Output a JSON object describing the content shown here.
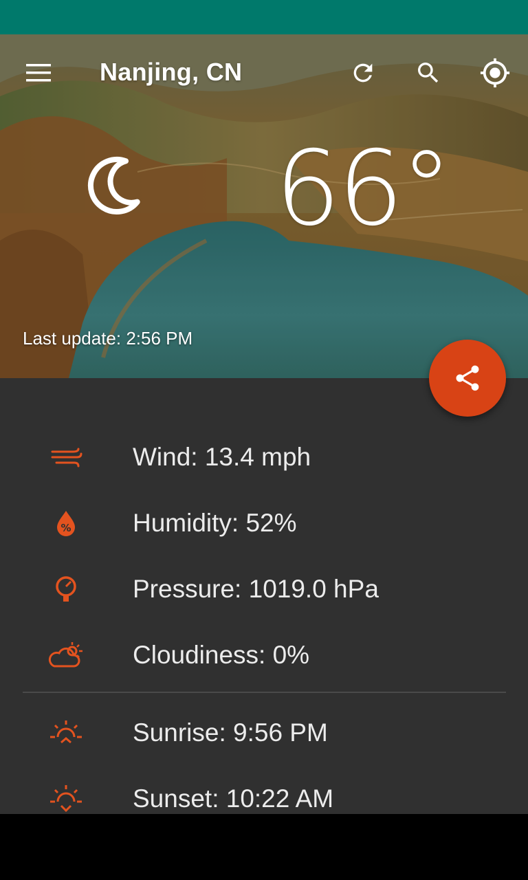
{
  "app": {
    "accent_color": "#d84315",
    "status_bar_color": "#00796b",
    "panel_color": "#303030"
  },
  "toolbar": {
    "city": "Nanjing, CN",
    "menu_icon": "menu-icon",
    "refresh_icon": "refresh-icon",
    "search_icon": "search-icon",
    "location_icon": "my-location-icon"
  },
  "current": {
    "temperature": "66°",
    "condition_icon": "moon-night-icon",
    "last_update": "Last update: 2:56 PM"
  },
  "share": {
    "icon": "share-icon"
  },
  "details": [
    {
      "icon": "wind-icon",
      "text": "Wind: 13.4 mph"
    },
    {
      "icon": "humidity-icon",
      "text": "Humidity: 52%"
    },
    {
      "icon": "pressure-icon",
      "text": "Pressure: 1019.0 hPa"
    },
    {
      "icon": "cloudiness-icon",
      "text": "Cloudiness: 0%"
    }
  ],
  "sun": [
    {
      "icon": "sunrise-icon",
      "text": "Sunrise: 9:56 PM"
    },
    {
      "icon": "sunset-icon",
      "text": "Sunset: 10:22 AM"
    }
  ]
}
